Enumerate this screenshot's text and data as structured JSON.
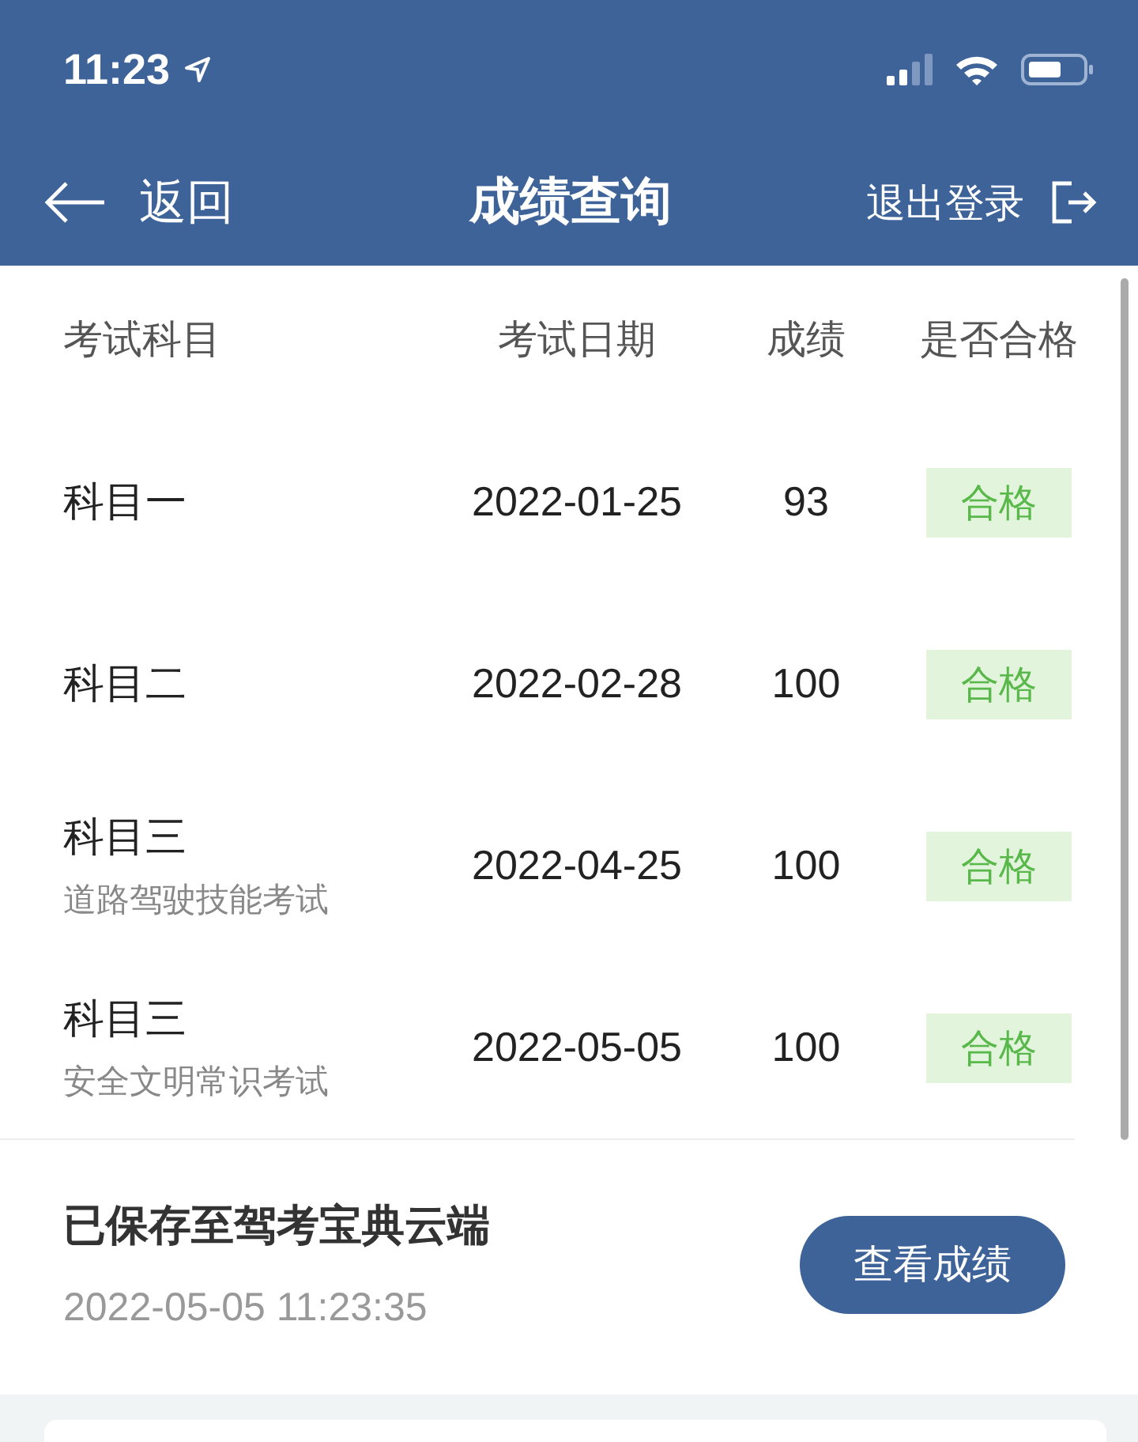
{
  "status_bar": {
    "time": "11:23"
  },
  "nav": {
    "back": "返回",
    "title": "成绩查询",
    "logout": "退出登录"
  },
  "table": {
    "columns": [
      "考试科目",
      "考试日期",
      "成绩",
      "是否合格"
    ],
    "rows": [
      {
        "subject": "科目一",
        "date": "2022-01-25",
        "score": "93",
        "result": "合格",
        "passed": true
      },
      {
        "subject": "科目二",
        "date": "2022-02-28",
        "score": "100",
        "result": "合格",
        "passed": true
      },
      {
        "subject": "科目三",
        "note": "道路驾驶技能考试",
        "date": "2022-04-25",
        "score": "100",
        "result": "合格",
        "passed": true
      },
      {
        "subject": "科目三",
        "note": "安全文明常识考试",
        "date": "2022-05-05",
        "score": "100",
        "result": "合格",
        "passed": true
      }
    ]
  },
  "footer": {
    "message": "已保存至驾考宝典云端",
    "time": "2022-05-05 11:23:35",
    "button": "查看成绩"
  }
}
